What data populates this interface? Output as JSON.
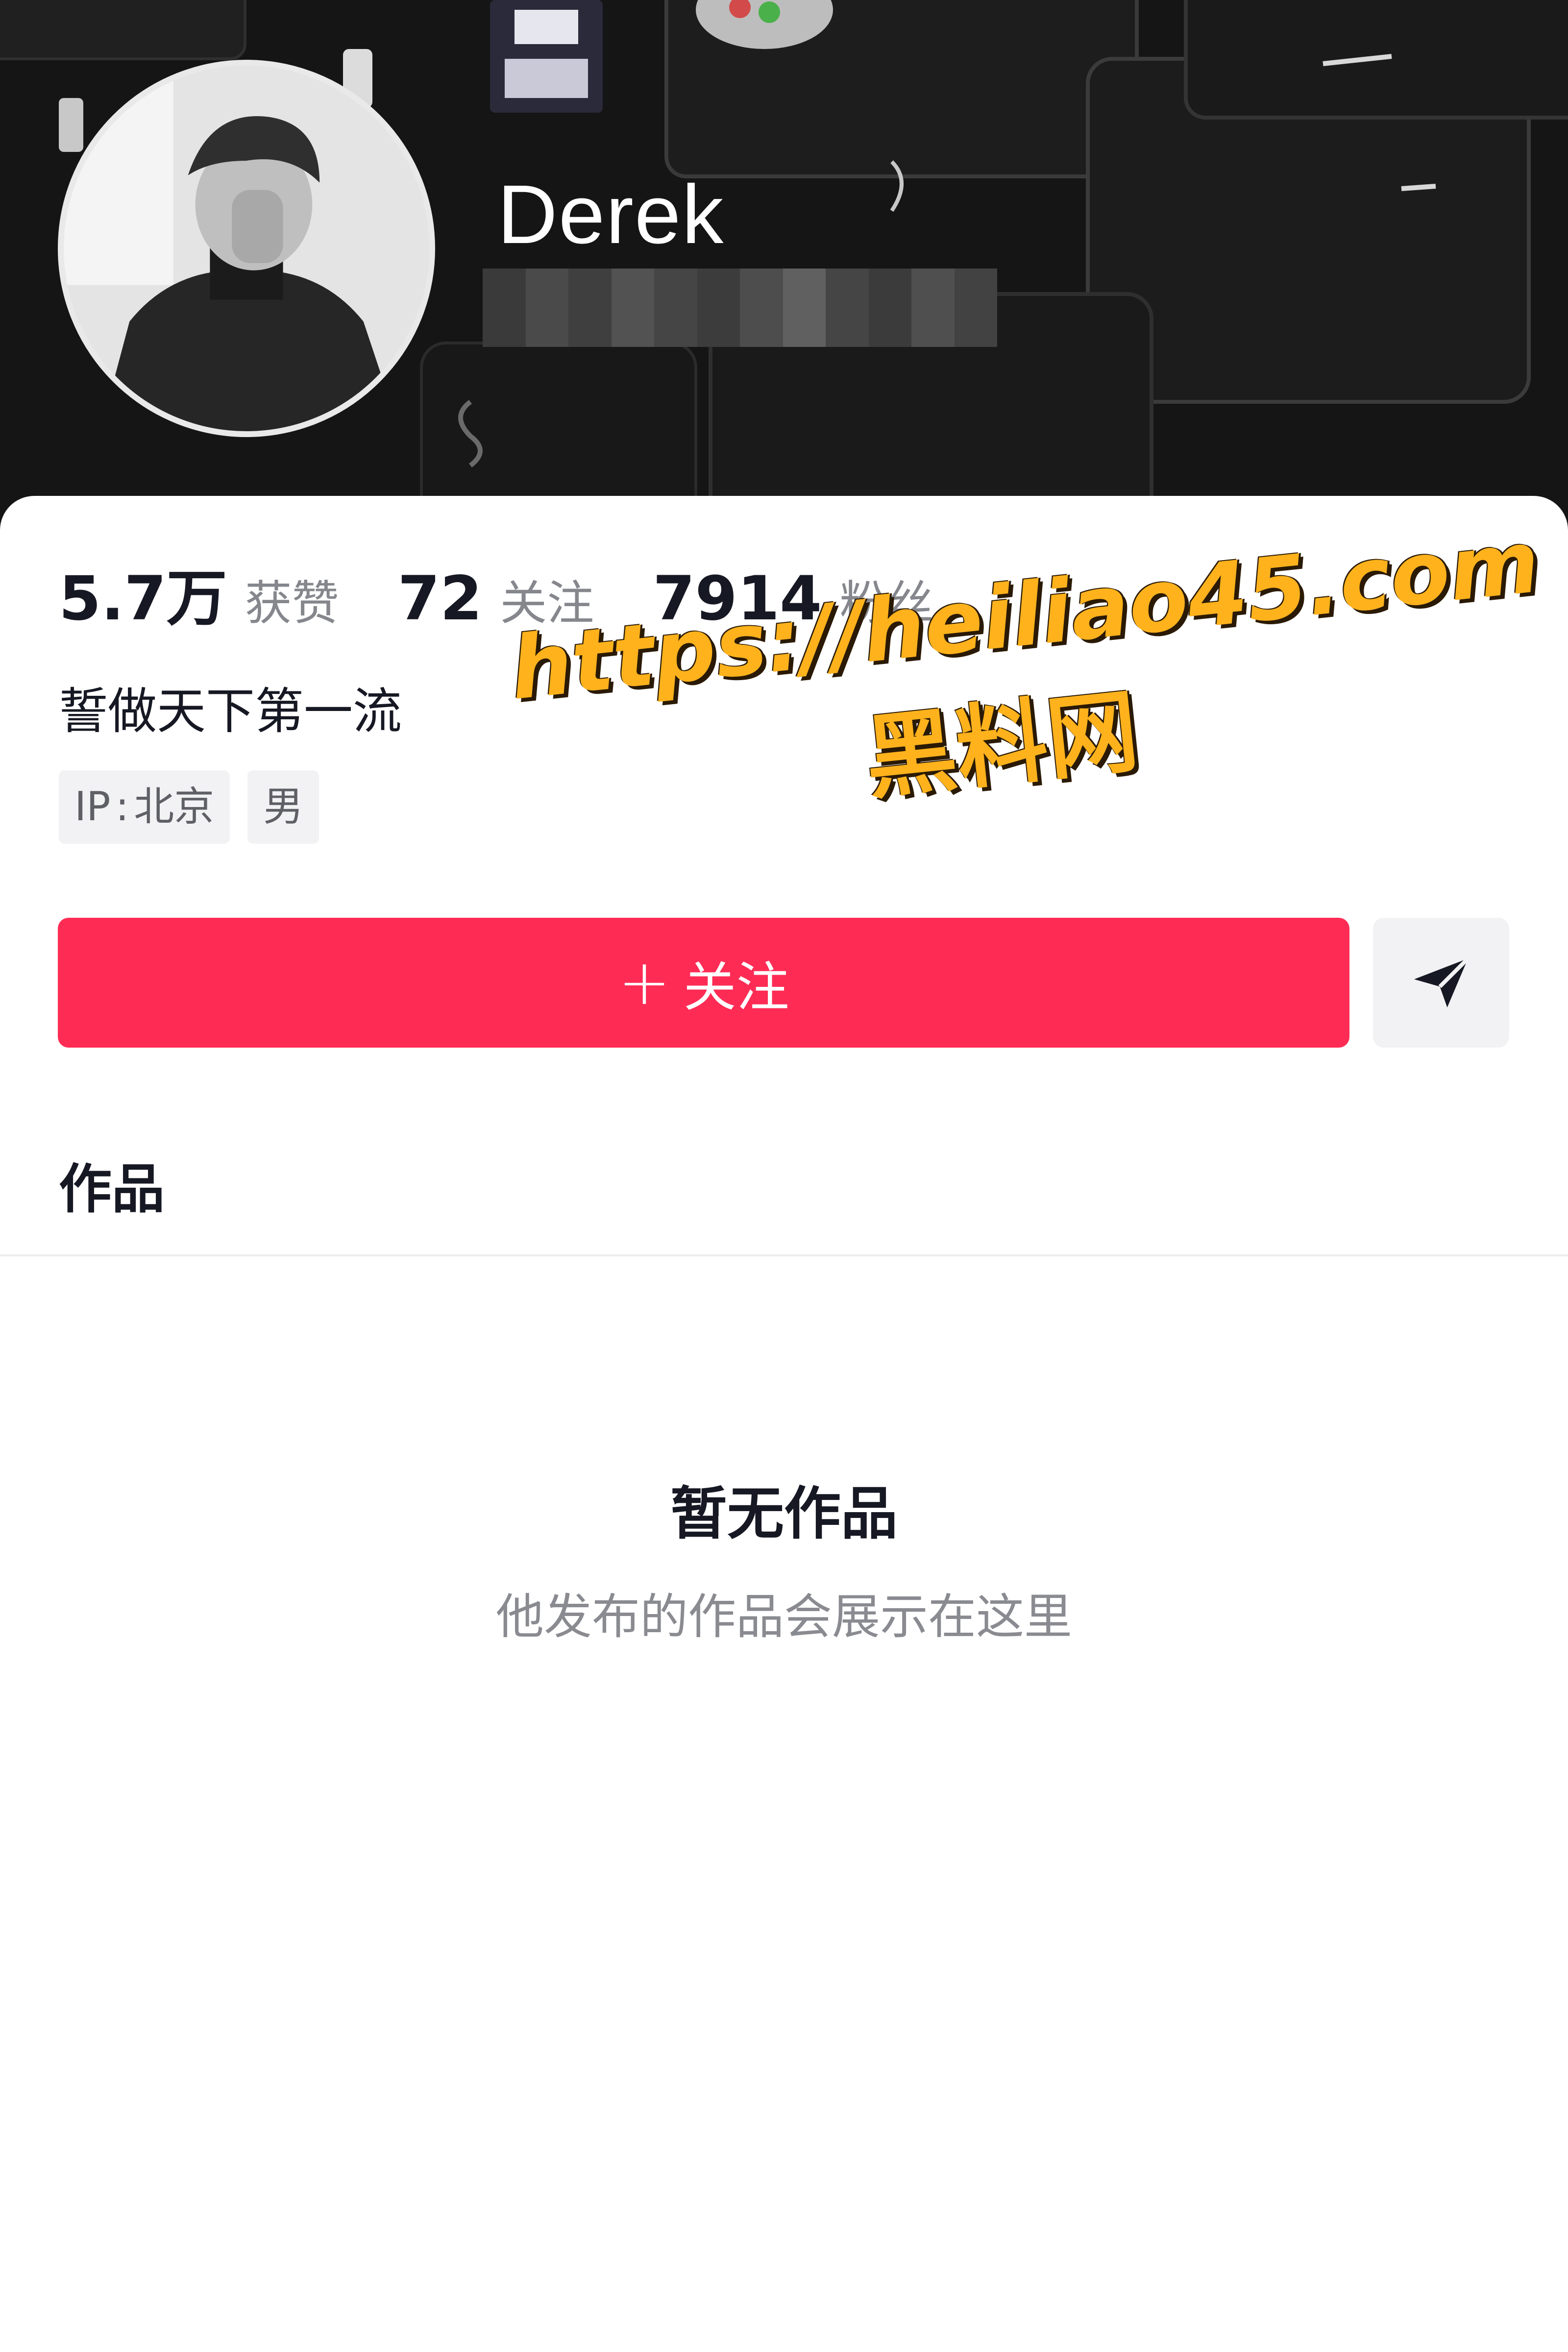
{
  "profile": {
    "nickname": "Derek",
    "bio": "誓做天下第一流",
    "avatar": "avatar-photo"
  },
  "stats": [
    {
      "value": "5.7万",
      "label": "获赞"
    },
    {
      "value": "72",
      "label": "关注"
    },
    {
      "value": "7914",
      "label": "粉丝"
    }
  ],
  "tags": {
    "ip_label": "IP",
    "ip_sep": ":",
    "ip_value": "北京",
    "gender": "男"
  },
  "actions": {
    "follow_plus": "+",
    "follow_label": "关注",
    "share_icon": "paper-plane-icon"
  },
  "tabs": {
    "works_label": "作品"
  },
  "empty_state": {
    "title": "暂无作品",
    "subtitle": "他发布的作品会展示在这里"
  },
  "watermark": {
    "url": "https://heiliao45.com",
    "name": "黑料网"
  },
  "colors": {
    "accent": "#fe2c55",
    "banner": "#141414",
    "watermark": "#ffb21c"
  }
}
